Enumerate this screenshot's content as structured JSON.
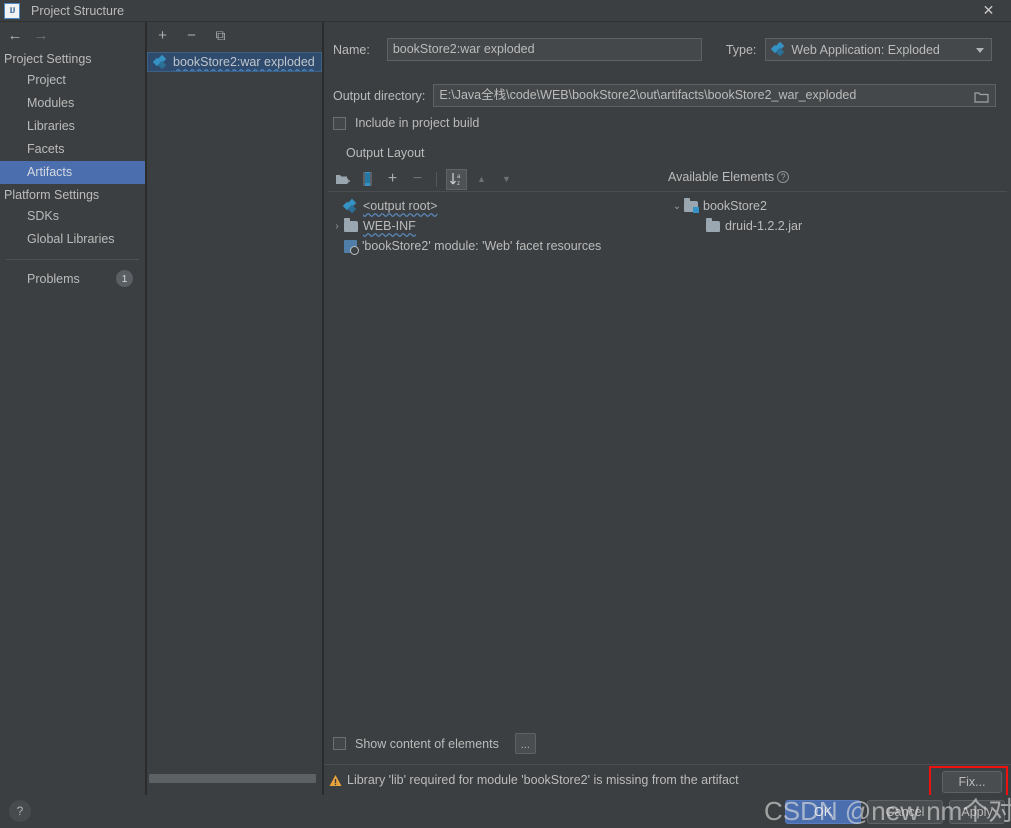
{
  "window": {
    "title": "Project Structure",
    "app_icon": "intellij-idea-icon",
    "close_label": "✕"
  },
  "nav": {
    "back": "←",
    "forward": "→"
  },
  "sidebar": {
    "groups": [
      {
        "label": "Project Settings",
        "items": [
          {
            "label": "Project",
            "selected": false
          },
          {
            "label": "Modules",
            "selected": false
          },
          {
            "label": "Libraries",
            "selected": false
          },
          {
            "label": "Facets",
            "selected": false
          },
          {
            "label": "Artifacts",
            "selected": true
          }
        ]
      },
      {
        "label": "Platform Settings",
        "items": [
          {
            "label": "SDKs",
            "selected": false
          },
          {
            "label": "Global Libraries",
            "selected": false
          }
        ]
      }
    ],
    "problems": {
      "label": "Problems",
      "count": "1"
    }
  },
  "artifact_panel": {
    "toolbar": [
      {
        "name": "add-artifact-button",
        "glyph": "+"
      },
      {
        "name": "remove-artifact-button",
        "glyph": "−"
      },
      {
        "name": "copy-artifact-button",
        "glyph": "⧉"
      }
    ],
    "items": [
      {
        "label": "bookStore2:war exploded",
        "icon": "artifact-icon",
        "selected": true,
        "error": true
      }
    ]
  },
  "details": {
    "name_label": "Name:",
    "name_value": "bookStore2:war exploded",
    "type_label": "Type:",
    "type_value": "Web Application: Exploded",
    "type_icon": "artifact-icon",
    "output_dir_label": "Output directory:",
    "output_dir_value": "E:\\Java全栈\\code\\WEB\\bookStore2\\out\\artifacts\\bookStore2_war_exploded",
    "browse_icon": "folder-icon",
    "include_in_build_label": "Include in project build",
    "include_in_build_checked": false,
    "output_layout_label": "Output Layout"
  },
  "layout_toolbar": [
    {
      "name": "add-directory-button",
      "glyph": "▮",
      "state": "enabled"
    },
    {
      "name": "add-archive-button",
      "glyph": "▯",
      "state": "enabled"
    },
    {
      "name": "add-copy-button",
      "glyph": "+",
      "state": "enabled"
    },
    {
      "name": "remove-element-button",
      "glyph": "−",
      "state": "disabled"
    },
    {
      "name": "sort-button",
      "glyph": "↓",
      "state": "active"
    },
    {
      "name": "move-up-button",
      "glyph": "▲",
      "state": "disabled"
    },
    {
      "name": "move-down-button",
      "glyph": "▼",
      "state": "disabled"
    }
  ],
  "output_tree": {
    "nodes": [
      {
        "label": "<output root>",
        "icon": "artifact-icon",
        "indent": 0,
        "twisty": "",
        "wavy": true
      },
      {
        "label": "WEB-INF",
        "icon": "folder-icon",
        "indent": 0,
        "twisty": "›",
        "wavy": true
      },
      {
        "label": "'bookStore2' module: 'Web' facet resources",
        "icon": "module-icon",
        "indent": 1,
        "twisty": "",
        "wavy": false
      }
    ]
  },
  "available_elements": {
    "title": "Available Elements",
    "help_glyph": "?",
    "nodes": [
      {
        "label": "bookStore2",
        "icon": "module-folder-icon",
        "indent": 0,
        "twisty": "⌄"
      },
      {
        "label": "druid-1.2.2.jar",
        "icon": "folder-icon",
        "indent": 1,
        "twisty": ""
      }
    ]
  },
  "bottom": {
    "show_content_label": "Show content of elements",
    "show_content_checked": false,
    "dots_button_label": "...",
    "warning_icon": "warning-triangle-icon",
    "warning_text": "Library 'lib' required for module 'bookStore2' is missing from the artifact",
    "fix_label": "Fix...",
    "fix_highlight_color": "#ee1111"
  },
  "dialog_buttons": {
    "help_label": "?",
    "ok_label": "OK",
    "cancel_label": "Cancel",
    "apply_label": "Apply"
  },
  "watermark": {
    "text": "CSDN @new nm个对象"
  },
  "colors": {
    "background": "#3c3f41",
    "selection": "#4b6eaf",
    "accent": "#3592c4",
    "warning": "#e8a33d",
    "highlight": "#ee1111"
  }
}
